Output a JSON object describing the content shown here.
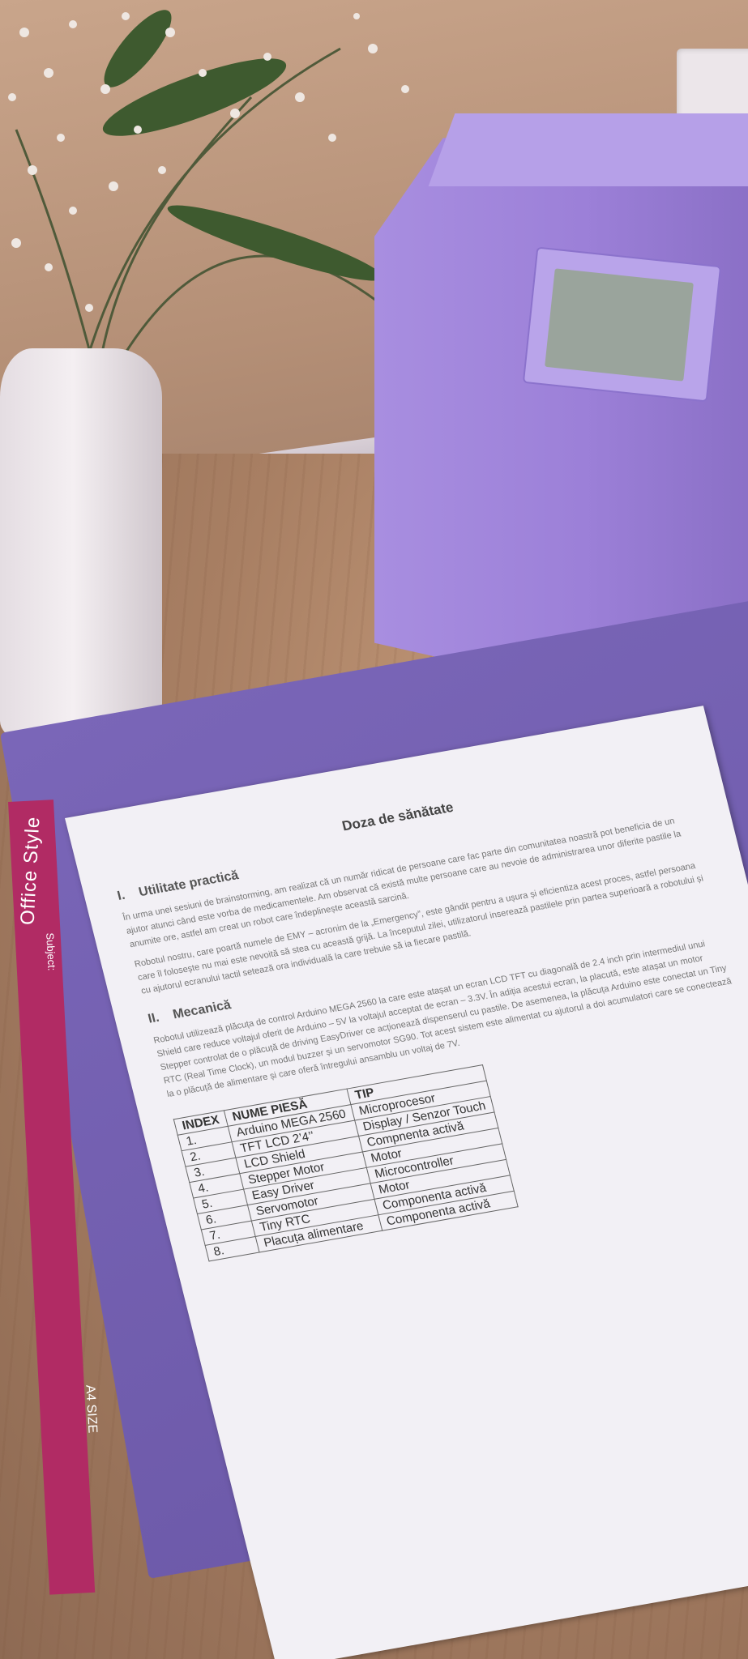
{
  "folder": {
    "brand": "Office Style",
    "size_label": "A4 SIZE",
    "subject_label": "Subject:"
  },
  "document": {
    "title": "Doza de sănătate",
    "section1": {
      "number": "I.",
      "heading": "Utilitate practică",
      "paragraphs": [
        "În urma unei sesiuni de brainstorming, am realizat că un număr ridicat de persoane care fac parte din comunitatea noastră pot beneficia de un ajutor atunci când este vorba de medicamentele. Am observat că există multe persoane care au nevoie de administrarea unor diferite pastile la anumite ore, astfel am creat un robot care îndeplinește această sarcină.",
        "Robotul nostru, care poartă numele de EMY – acronim de la „Emergency”, este gândit pentru a ușura și eficientiza acest proces, astfel persoana care îl folosește nu mai este nevoită să stea cu această grijă. La începutul zilei, utilizatorul inserează pastilele prin partea superioară a robotului și cu ajutorul ecranului tactil setează ora individuală la care trebuie să ia fiecare pastilă."
      ]
    },
    "section2": {
      "number": "II.",
      "heading": "Mecanică",
      "paragraphs": [
        "Robotul utilizează plăcuța de control Arduino MEGA 2560 la care este atașat un ecran LCD TFT cu diagonală de 2.4 inch prin intermediul unui Shield care reduce voltajul oferit de Arduino – 5V la voltajul acceptat de ecran – 3.3V. În adiția acestui ecran, la placută, este atașat un motor Stepper controlat de o plăcuță de driving EasyDriver ce acționează dispenserul cu pastile. De asemenea, la plăcuța Arduino este conectat un Tiny RTC (Real Time Clock), un modul buzzer și un servomotor SG90. Tot acest sistem este alimentat cu ajutorul a doi acumulatori care se conectează la o plăcuță de alimentare și care oferă întregului ansamblu un voltaj de 7V."
      ]
    },
    "table": {
      "headers": [
        "INDEX",
        "NUME PIESĂ",
        "TIP"
      ],
      "rows": [
        [
          "1.",
          "Arduino MEGA 2560",
          "Microprocesor"
        ],
        [
          "2.",
          "TFT LCD 2’4’’",
          "Display / Senzor Touch"
        ],
        [
          "3.",
          "LCD Shield",
          "Compnenta activă"
        ],
        [
          "4.",
          "Stepper Motor",
          "Motor"
        ],
        [
          "5.",
          "Easy Driver",
          "Microcontroller"
        ],
        [
          "6.",
          "Servomotor",
          "Motor"
        ],
        [
          "7.",
          "Tiny RTC",
          "Componenta activă"
        ],
        [
          "8.",
          "Placuța alimentare",
          "Componenta activă"
        ]
      ]
    }
  }
}
